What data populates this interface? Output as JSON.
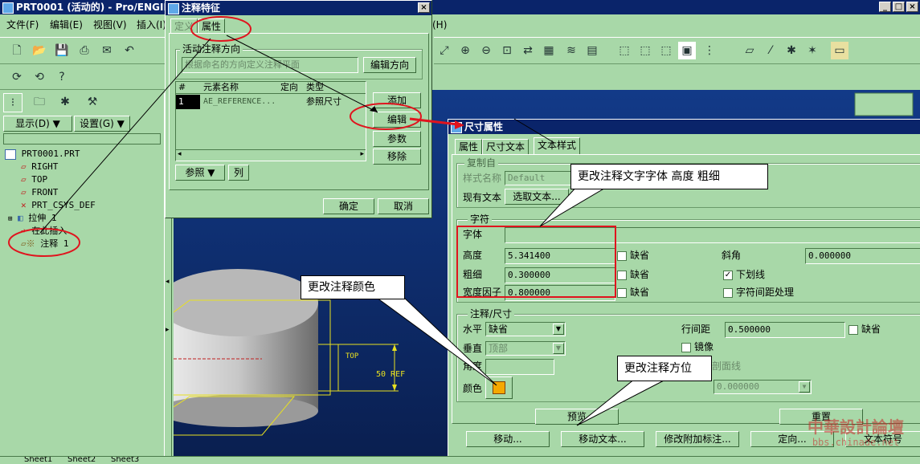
{
  "main_window": {
    "title": "PRT0001 (活动的) - Pro/ENGINEER",
    "menu": [
      "文件(F)",
      "编辑(E)",
      "视图(V)",
      "插入(I)",
      "(H)"
    ],
    "buttons": {
      "display": "显示(D) ▼",
      "settings": "设置(G) ▼"
    },
    "tree": [
      {
        "label": "PRT0001.PRT",
        "icon": "part-icon",
        "level": 0
      },
      {
        "label": "RIGHT",
        "icon": "datum-plane-icon",
        "level": 1
      },
      {
        "label": "TOP",
        "icon": "datum-plane-icon",
        "level": 1
      },
      {
        "label": "FRONT",
        "icon": "datum-plane-icon",
        "level": 1
      },
      {
        "label": "PRT_CSYS_DEF",
        "icon": "csys-icon",
        "level": 1
      },
      {
        "label": "拉伸 1",
        "icon": "extrude-icon",
        "level": 1
      },
      {
        "label": "在此插入",
        "icon": "insert-arrow-icon",
        "level": 1
      },
      {
        "label": "注释 1",
        "icon": "note-icon",
        "level": 1
      }
    ],
    "sheet_tabs": [
      "Sheet1",
      "Sheet2",
      "Sheet3"
    ],
    "viewport": {
      "datum_label": "TOP",
      "dimension_text": "50 REF"
    }
  },
  "note_dialog": {
    "title": "注释特征",
    "tabs": [
      "定义",
      "属性"
    ],
    "group_label": "活动注释方向",
    "direction_field": "根据命名的方向定义注释平面",
    "edit_direction_btn": "编辑方向",
    "table_headers": [
      "#",
      "元素名称",
      "定向",
      "类型"
    ],
    "table_row": {
      "num": "1",
      "name": "AE_REFERENCE...",
      "type": "参照尺寸"
    },
    "side_buttons": {
      "add": "添加",
      "edit": "编辑",
      "params": "参数",
      "remove": "移除"
    },
    "bottom": {
      "refs": "参照 ▼",
      "col": "列"
    },
    "ok": "确定",
    "cancel": "取消"
  },
  "dim_dialog": {
    "title": "尺寸属性",
    "tabs": [
      "属性",
      "尺寸文本",
      "文本样式"
    ],
    "copy_group": "复制自",
    "style_name_label": "样式名称",
    "style_name_value": "Default",
    "existing_text_label": "现有文本",
    "select_text_btn": "选取文本...",
    "char_group": "字符",
    "font_label": "字体",
    "height_label": "高度",
    "height_value": "5.341400",
    "thick_label": "粗细",
    "thick_value": "0.300000",
    "width_label": "宽度因子",
    "width_value": "0.800000",
    "default_label": "缺省",
    "slant_label": "斜角",
    "slant_value": "0.000000",
    "underline_label": "下划线",
    "kerning_label": "字符间距处理",
    "note_group": "注释/尺寸",
    "horiz_label": "水平",
    "horiz_value": "缺省",
    "vert_label": "垂直",
    "vert_value": "顶部",
    "angle_label": "角度",
    "color_label": "颜色",
    "color_value": "#f5a800",
    "line_spacing_label": "行间距",
    "line_spacing_value": "0.500000",
    "mirror_label": "镜像",
    "hatch_label": "剖面线",
    "hatch_value": "0.000000",
    "preview_btn": "预览",
    "reset_btn": "重置",
    "move_btn": "移动...",
    "move_text_btn": "移动文本...",
    "modify_attach_btn": "修改附加标注...",
    "orient_btn": "定向...",
    "text_symbol_btn": "文本符号"
  },
  "callouts": {
    "font": "更改注释文字字体  高度   粗细",
    "color": "更改注释颜色",
    "position": "更改注释方位"
  },
  "watermark": {
    "title": "中華設計論壇",
    "url": "bbs.chinade.net"
  },
  "colors": {
    "highlight": "#e0141e",
    "panel": "#a8d8a8",
    "titlebar": "#0a246a",
    "viewport": "#0e2a68"
  }
}
